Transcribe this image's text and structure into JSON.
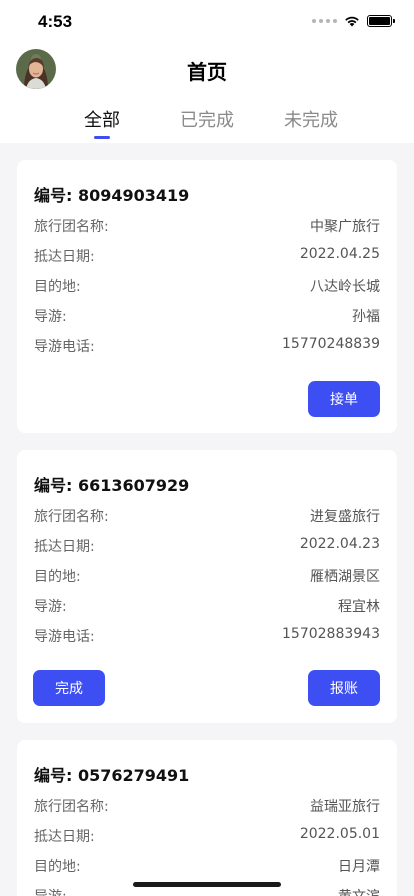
{
  "status_bar": {
    "time": "4:53"
  },
  "header": {
    "title": "首页"
  },
  "tabs": [
    {
      "label": "全部",
      "active": true
    },
    {
      "label": "已完成",
      "active": false
    },
    {
      "label": "未完成",
      "active": false
    }
  ],
  "cards": [
    {
      "id_label": "编号: 8094903419",
      "rows": [
        {
          "label": "旅行团名称:",
          "value": "中聚广旅行"
        },
        {
          "label": "抵达日期:",
          "value": "2022.04.25"
        },
        {
          "label": "目的地:",
          "value": "八达岭长城"
        },
        {
          "label": "导游:",
          "value": "孙福"
        },
        {
          "label": "导游电话:",
          "value": "15770248839"
        }
      ],
      "buttons": {
        "right": "接单"
      }
    },
    {
      "id_label": "编号: 6613607929",
      "rows": [
        {
          "label": "旅行团名称:",
          "value": "进复盛旅行"
        },
        {
          "label": "抵达日期:",
          "value": "2022.04.23"
        },
        {
          "label": "目的地:",
          "value": "雁栖湖景区"
        },
        {
          "label": "导游:",
          "value": "程宜林"
        },
        {
          "label": "导游电话:",
          "value": "15702883943"
        }
      ],
      "buttons": {
        "left": "完成",
        "right": "报账"
      }
    },
    {
      "id_label": "编号: 0576279491",
      "rows": [
        {
          "label": "旅行团名称:",
          "value": "益瑞亚旅行"
        },
        {
          "label": "抵达日期:",
          "value": "2022.05.01"
        },
        {
          "label": "目的地:",
          "value": "日月潭"
        },
        {
          "label": "导游:",
          "value": "黄文滨"
        }
      ]
    }
  ],
  "colors": {
    "accent": "#3d4ef2",
    "background": "#f5f5f7",
    "card": "#ffffff"
  },
  "icons": [
    "signal-dots-icon",
    "wifi-icon",
    "battery-icon",
    "avatar"
  ]
}
